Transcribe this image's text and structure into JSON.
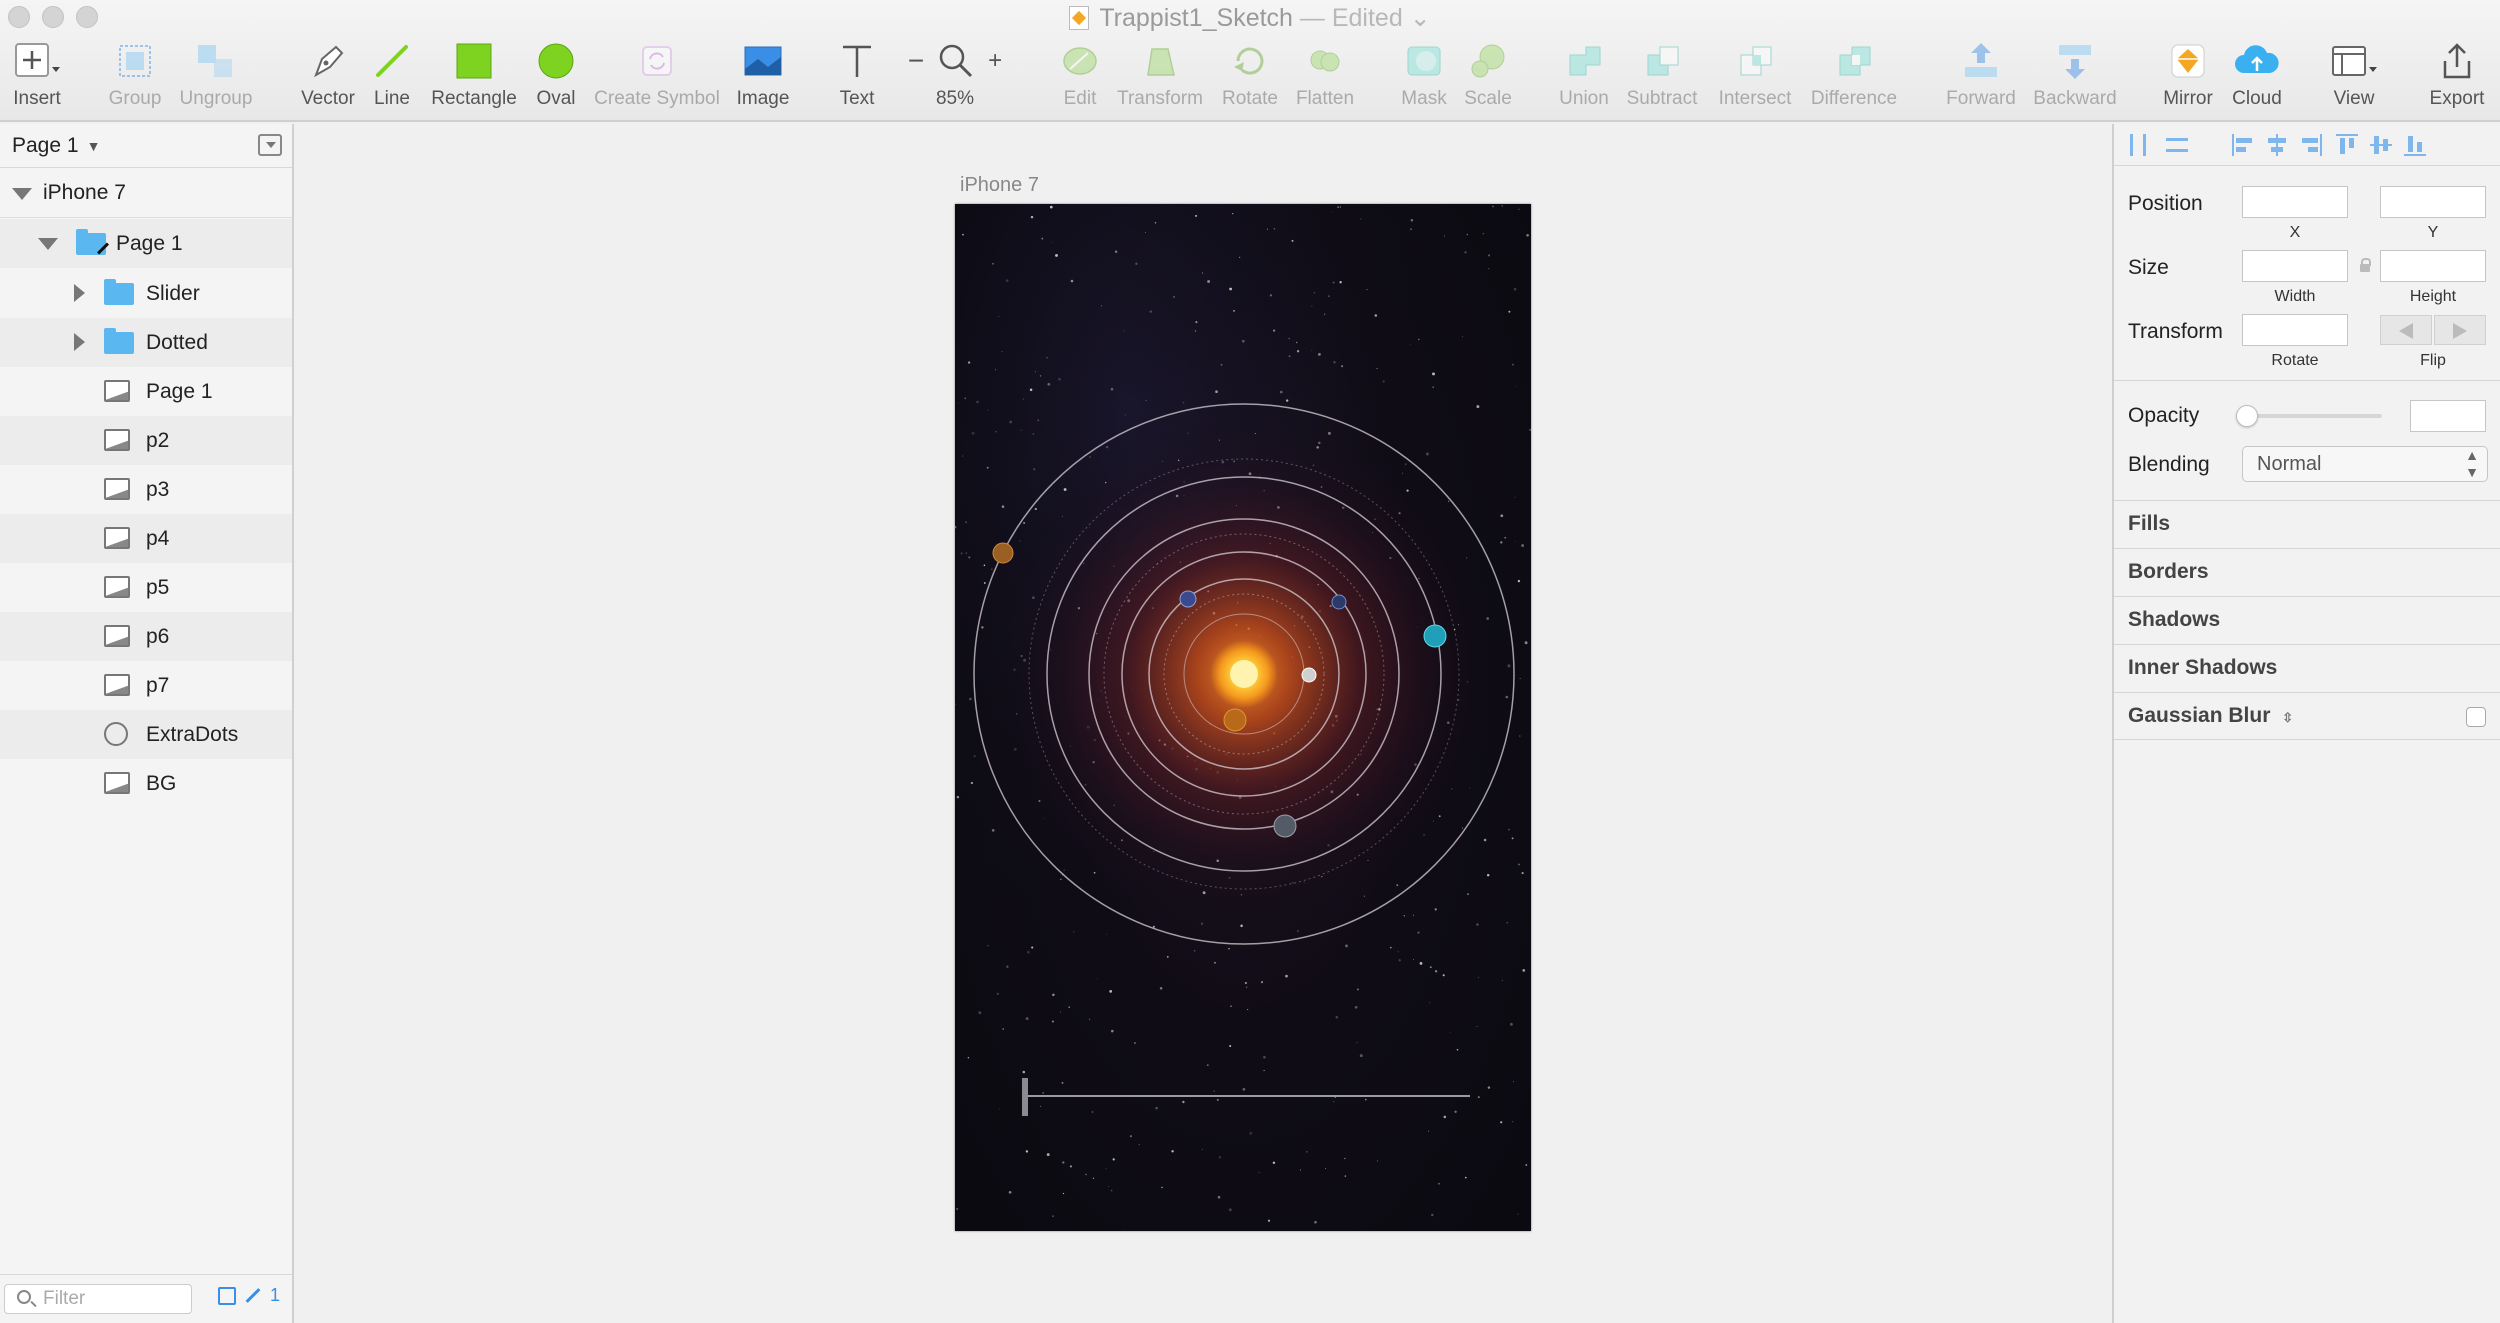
{
  "window": {
    "title": "Trappist1_Sketch",
    "edited": "— Edited",
    "title_chevron": "⌄"
  },
  "toolbar": {
    "insert": "Insert",
    "group": "Group",
    "ungroup": "Ungroup",
    "vector": "Vector",
    "line": "Line",
    "rectangle": "Rectangle",
    "oval": "Oval",
    "create_symbol": "Create Symbol",
    "image": "Image",
    "text": "Text",
    "zoom": "85%",
    "zoom_minus": "−",
    "zoom_plus": "+",
    "edit": "Edit",
    "transform": "Transform",
    "rotate": "Rotate",
    "flatten": "Flatten",
    "mask": "Mask",
    "scale": "Scale",
    "union": "Union",
    "subtract": "Subtract",
    "intersect": "Intersect",
    "difference": "Difference",
    "forward": "Forward",
    "backward": "Backward",
    "mirror": "Mirror",
    "cloud": "Cloud",
    "view": "View",
    "export": "Export",
    "colors": {
      "accent_blue": "#3a8ee6",
      "light_teal": "#7fe0d6",
      "rectangle_green": "#7ed321",
      "sketch_orange": "#f5a623"
    }
  },
  "layers": {
    "page_selector": "Page 1",
    "rows": [
      {
        "label": "iPhone 7",
        "icon": "artboard",
        "indent": 0,
        "expanded": true
      },
      {
        "label": "Page 1",
        "icon": "folder-icon",
        "indent": 1,
        "expanded": true
      },
      {
        "label": "Slider",
        "icon": "folder-icon",
        "indent": 2,
        "expanded": false
      },
      {
        "label": "Dotted",
        "icon": "folder-icon",
        "indent": 2,
        "expanded": false
      },
      {
        "label": "Page 1",
        "icon": "image-icon",
        "indent": 2
      },
      {
        "label": "p2",
        "icon": "image-icon",
        "indent": 2
      },
      {
        "label": "p3",
        "icon": "image-icon",
        "indent": 2
      },
      {
        "label": "p4",
        "icon": "image-icon",
        "indent": 2
      },
      {
        "label": "p5",
        "icon": "image-icon",
        "indent": 2
      },
      {
        "label": "p6",
        "icon": "image-icon",
        "indent": 2
      },
      {
        "label": "p7",
        "icon": "image-icon",
        "indent": 2
      },
      {
        "label": "ExtraDots",
        "icon": "oval-icon",
        "indent": 2
      },
      {
        "label": "BG",
        "icon": "image-icon",
        "indent": 2
      }
    ],
    "filter_placeholder": "Filter",
    "edited_count": "1"
  },
  "canvas": {
    "artboard_title": "iPhone 7",
    "background_color": "#0b0b12",
    "sun_color": "#ffb020"
  },
  "inspector": {
    "position": "Position",
    "x": "X",
    "y": "Y",
    "size": "Size",
    "width": "Width",
    "height": "Height",
    "transform": "Transform",
    "rotate": "Rotate",
    "flip": "Flip",
    "opacity": "Opacity",
    "blending": "Blending",
    "blending_value": "Normal",
    "sections": [
      "Fills",
      "Borders",
      "Shadows",
      "Inner Shadows",
      "Gaussian Blur"
    ]
  }
}
